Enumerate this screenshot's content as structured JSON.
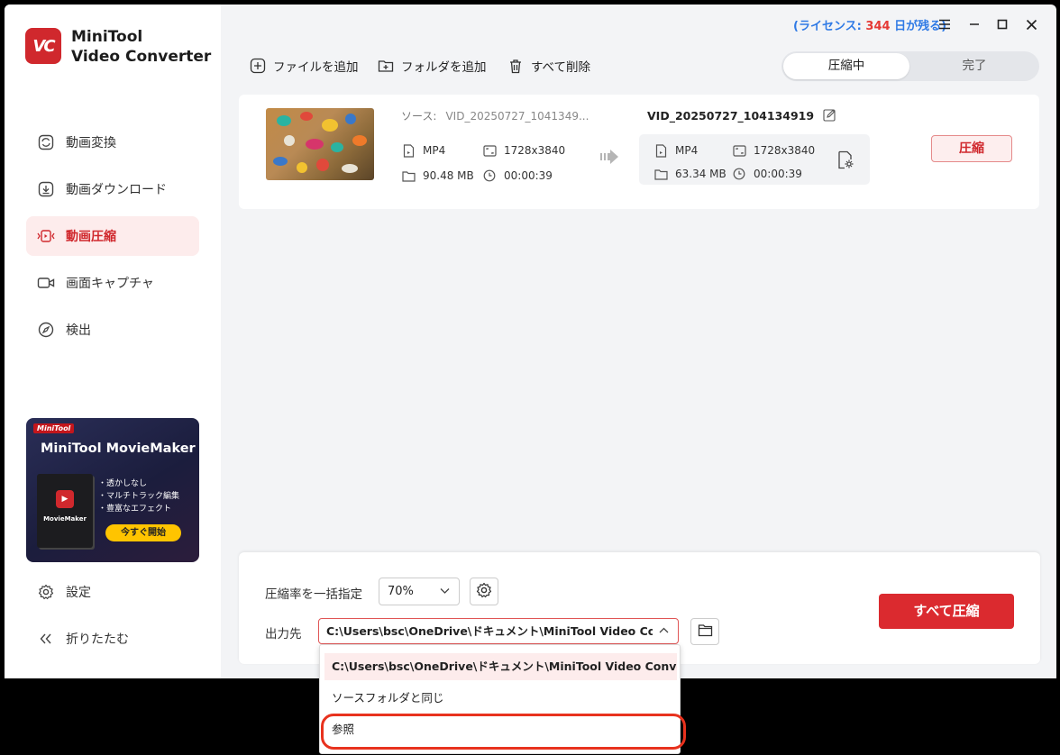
{
  "app": {
    "name_line1": "MiniTool",
    "name_line2": "Video Converter",
    "logo_text": "VC"
  },
  "titlebar": {
    "license_prefix": "(ライセンス: ",
    "license_count": "344",
    "license_suffix": " 日が残る)"
  },
  "sidebar": {
    "items": [
      {
        "label": "動画変換",
        "icon": "convert-icon"
      },
      {
        "label": "動画ダウンロード",
        "icon": "download-icon"
      },
      {
        "label": "動画圧縮",
        "icon": "compress-icon"
      },
      {
        "label": "画面キャプチャ",
        "icon": "camera-icon"
      },
      {
        "label": "検出",
        "icon": "compass-icon"
      }
    ],
    "settings_label": "設定",
    "collapse_label": "折りたたむ"
  },
  "promo": {
    "badge": "MiniTool",
    "title": "MiniTool MovieMaker",
    "box_name": "MovieMaker",
    "features": [
      "・透かしなし",
      "・マルチトラック編集",
      "・豊富なエフェクト"
    ],
    "cta": "今すぐ開始"
  },
  "toolbar": {
    "add_file": "ファイルを追加",
    "add_folder": "フォルダを追加",
    "delete_all": "すべて削除"
  },
  "tabs": {
    "compressing": "圧縮中",
    "done": "完了"
  },
  "file": {
    "source_label": "ソース:",
    "source_name": "VID_20250727_1041349...",
    "src_format": "MP4",
    "src_resolution": "1728x3840",
    "src_size": "90.48 MB",
    "src_duration": "00:00:39",
    "output_name": "VID_20250727_104134919",
    "out_format": "MP4",
    "out_resolution": "1728x3840",
    "out_size": "63.34 MB",
    "out_duration": "00:00:39",
    "compress_button": "圧縮"
  },
  "bottom": {
    "rate_label": "圧縮率を一括指定",
    "rate_value": "70%",
    "output_label": "出力先",
    "output_path": "C:\\Users\\bsc\\OneDrive\\ドキュメント\\MiniTool Video Converter\\Com",
    "compress_all": "すべて圧縮"
  },
  "dropdown": {
    "options": [
      "C:\\Users\\bsc\\OneDrive\\ドキュメント\\MiniTool Video Converter\\Co...",
      "ソースフォルダと同じ",
      "参照"
    ]
  },
  "colors": {
    "accent": "#d0282d",
    "license_blue": "#2f7ae5",
    "highlight": "#e8321e"
  }
}
